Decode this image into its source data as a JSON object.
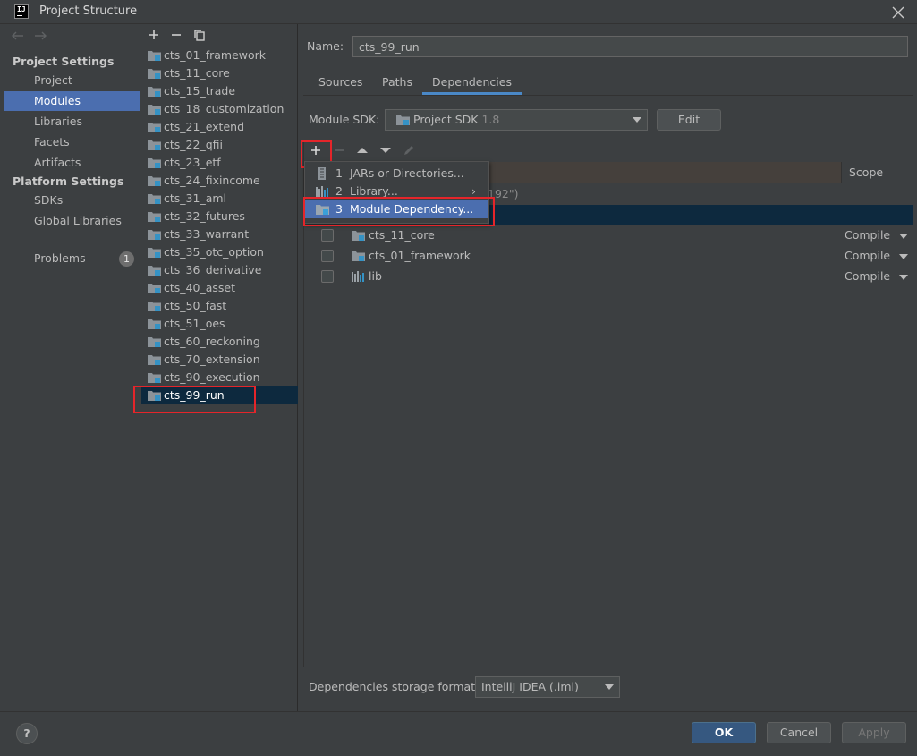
{
  "window": {
    "title": "Project Structure"
  },
  "nav": {
    "project_settings_header": "Project Settings",
    "project_items": [
      "Project",
      "Modules",
      "Libraries",
      "Facets",
      "Artifacts"
    ],
    "platform_settings_header": "Platform Settings",
    "platform_items": [
      "SDKs",
      "Global Libraries"
    ],
    "problems_label": "Problems",
    "problems_count": "1",
    "selected": "Modules"
  },
  "modules": {
    "items": [
      "cts_01_framework",
      "cts_11_core",
      "cts_15_trade",
      "cts_18_customization",
      "cts_21_extend",
      "cts_22_qfii",
      "cts_23_etf",
      "cts_24_fixincome",
      "cts_31_aml",
      "cts_32_futures",
      "cts_33_warrant",
      "cts_35_otc_option",
      "cts_36_derivative",
      "cts_40_asset",
      "cts_50_fast",
      "cts_51_oes",
      "cts_60_reckoning",
      "cts_70_extension",
      "cts_90_execution",
      "cts_99_run"
    ],
    "selected": "cts_99_run"
  },
  "details": {
    "name_label": "Name:",
    "name_value": "cts_99_run",
    "tabs": [
      "Sources",
      "Paths",
      "Dependencies"
    ],
    "active_tab": "Dependencies",
    "sdk_label": "Module SDK:",
    "sdk_value": "Project SDK",
    "sdk_version": "1.8",
    "edit_label": "Edit",
    "scope_header": "Scope",
    "hidden_row_fragment": "192\")",
    "dependencies": [
      {
        "name": "cts_11_core",
        "scope": "Compile",
        "icon": "module-folder-icon"
      },
      {
        "name": "cts_01_framework",
        "scope": "Compile",
        "icon": "module-folder-icon"
      },
      {
        "name": "lib",
        "scope": "Compile",
        "icon": "library-icon"
      }
    ],
    "storage_label": "Dependencies storage format:",
    "storage_value": "IntelliJ IDEA (.iml)"
  },
  "popup": {
    "items": [
      {
        "num": "1",
        "label": "JARs or Directories...",
        "icon": "jar-icon"
      },
      {
        "num": "2",
        "label": "Library...",
        "icon": "library-icon"
      },
      {
        "num": "3",
        "label": "Module Dependency...",
        "icon": "module-folder-icon"
      }
    ]
  },
  "footer": {
    "ok": "OK",
    "cancel": "Cancel",
    "apply": "Apply",
    "help": "?"
  },
  "colors": {
    "background": "#3c3f41",
    "selection": "#4b6eaf",
    "tree_selection": "#0d293e",
    "highlight": "#e5252a",
    "primary_button": "#365880"
  }
}
